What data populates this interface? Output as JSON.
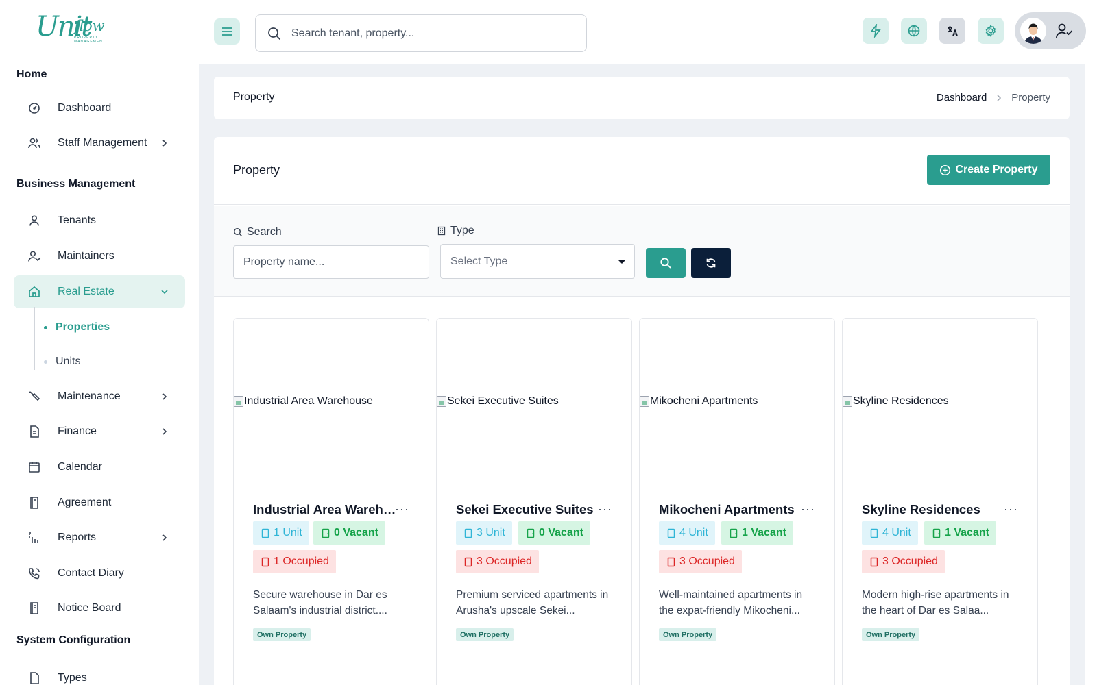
{
  "brand": {
    "script": "Unit",
    "word": "flow",
    "tagline": "property management"
  },
  "sidebar": {
    "sections": [
      "Home",
      "Business Management",
      "System Configuration"
    ],
    "items": [
      {
        "label": "Dashboard",
        "icon": "dashboard-gauge-icon"
      },
      {
        "label": "Staff Management",
        "icon": "users-icon"
      },
      {
        "label": "Tenants",
        "icon": "user-icon"
      },
      {
        "label": "Maintainers",
        "icon": "user-check-icon"
      },
      {
        "label": "Real Estate",
        "icon": "home-icon"
      },
      {
        "label": "Maintenance",
        "icon": "wrench-icon"
      },
      {
        "label": "Finance",
        "icon": "document-icon"
      },
      {
        "label": "Calendar",
        "icon": "calendar-icon"
      },
      {
        "label": "Agreement",
        "icon": "book-icon"
      },
      {
        "label": "Reports",
        "icon": "signal-bars-icon"
      },
      {
        "label": "Contact Diary",
        "icon": "phone-icon"
      },
      {
        "label": "Notice Board",
        "icon": "notice-book-icon"
      },
      {
        "label": "Types",
        "icon": "file-icon"
      }
    ],
    "sub_items": [
      {
        "label": "Properties"
      },
      {
        "label": "Units"
      }
    ]
  },
  "header": {
    "search_placeholder": "Search tenant, property...",
    "icons": [
      "menu-icon",
      "lightning-icon",
      "globe-icon",
      "translate-icon",
      "gear-icon",
      "user-check-icon"
    ]
  },
  "breadcrumb": {
    "title": "Property",
    "items": [
      "Dashboard",
      "Property"
    ]
  },
  "page": {
    "title": "Property",
    "create_label": "Create Property",
    "filters": {
      "search_label": "Search",
      "search_placeholder": "Property name...",
      "type_label": "Type",
      "type_value": "Select Type"
    }
  },
  "properties": [
    {
      "name": "Industrial Area Warehouse",
      "units": "1 Unit",
      "vacant": "0 Vacant",
      "occupied": "1 Occupied",
      "description": "Secure warehouse in Dar es Salaam's industrial district....",
      "tag": "Own Property"
    },
    {
      "name": "Sekei Executive Suites",
      "units": "3 Unit",
      "vacant": "0 Vacant",
      "occupied": "3 Occupied",
      "description": "Premium serviced apartments in Arusha's upscale Sekei...",
      "tag": "Own Property"
    },
    {
      "name": "Mikocheni Apartments",
      "units": "4 Unit",
      "vacant": "1 Vacant",
      "occupied": "3 Occupied",
      "description": "Well-maintained apartments in the expat-friendly Mikocheni...",
      "tag": "Own Property"
    },
    {
      "name": "Skyline Residences",
      "units": "4 Unit",
      "vacant": "1 Vacant",
      "occupied": "3 Occupied",
      "description": "Modern high-rise apartments in the heart of Dar es Salaa...",
      "tag": "Own Property"
    }
  ],
  "colors": {
    "accent": "#2a9d8f",
    "dark_button": "#0b1f3a",
    "vacant": "#16a34a",
    "occupied": "#dc2626",
    "unit": "#2fb5d6"
  }
}
